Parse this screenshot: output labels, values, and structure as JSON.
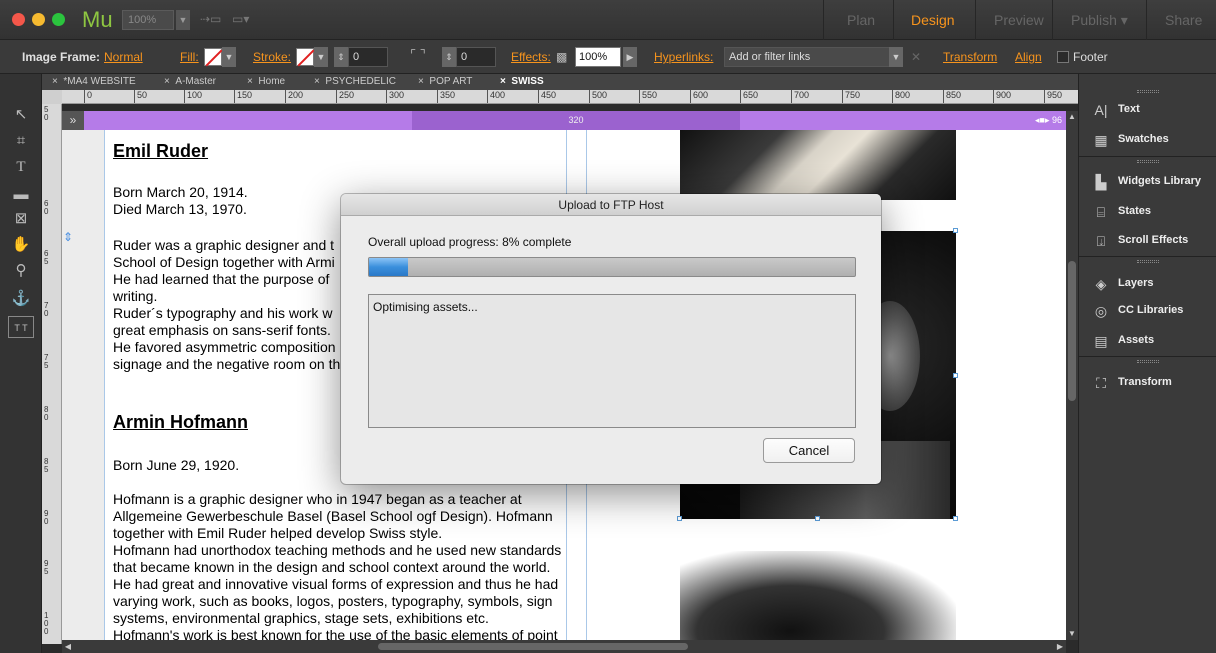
{
  "app": {
    "logo": "Mu",
    "zoom": "100%",
    "modes": [
      "Plan",
      "Design",
      "Preview",
      "Publish",
      "Share"
    ],
    "active_mode": "Design"
  },
  "control_bar": {
    "image_frame_label": "Image Frame:",
    "image_frame_value": "Normal",
    "fill_label": "Fill:",
    "stroke_label": "Stroke:",
    "stroke_value": "0",
    "corner_value": "0",
    "effects_label": "Effects:",
    "opacity": "100%",
    "hyperlinks_label": "Hyperlinks:",
    "hyperlinks_placeholder": "Add or filter links",
    "transform_label": "Transform",
    "align_label": "Align",
    "footer_label": "Footer"
  },
  "doc_tabs": [
    "*MA4 WEBSITE",
    "A-Master",
    "Home",
    "PSYCHEDELIC",
    "POP ART",
    "SWISS"
  ],
  "active_tab": "SWISS",
  "ruler": {
    "h_ticks": [
      "0",
      "50",
      "100",
      "150",
      "200",
      "250",
      "300",
      "350",
      "400",
      "450",
      "500",
      "550",
      "600",
      "650",
      "700",
      "750",
      "800",
      "850",
      "900",
      "950"
    ],
    "v_ticks": [
      "50",
      "60",
      "65",
      "70",
      "75",
      "80",
      "85",
      "90",
      "95",
      "100"
    ]
  },
  "breakpoint": {
    "width_label": "320",
    "right_label": "96"
  },
  "document": {
    "heading1": "Emil Ruder",
    "born1": "Born March 20, 1914.",
    "died1": "Died March 13, 1970.",
    "p1_lines": [
      "Ruder was a graphic designer and t",
      "School of Design together with Armi",
      "He had learned that the purpose of",
      "writing.",
      "Ruder´s typography and his work w",
      "great emphasis on sans-serif fonts.",
      "He favored asymmetric composition",
      "signage and the negative room on th"
    ],
    "heading2": "Armin Hofmann",
    "born2": "Born June 29, 1920.",
    "p2_lines": [
      "Hofmann is a graphic designer who in 1947 began as a teacher at",
      "Allgemeine Gewerbeschule Basel (Basel School ogf Design). Hofmann",
      "together with Emil Ruder helped develop Swiss style.",
      "Hofmann had unorthodox teaching methods and he used new standards",
      "that became known in the design and school context around the world.",
      "He had great and innovative visual forms of expression and thus he had",
      "varying work, such as books, logos, posters, typography, symbols, sign",
      "systems, environmental graphics, stage sets, exhibitions etc.",
      "Hofmann's work is best known for the use of the basic elements of point"
    ]
  },
  "right_panel": {
    "items": [
      "Text",
      "Swatches",
      "Widgets Library",
      "States",
      "Scroll Effects",
      "Layers",
      "CC Libraries",
      "Assets",
      "Transform"
    ]
  },
  "dialog": {
    "title": "Upload to FTP Host",
    "progress_label": "Overall upload progress: 8% complete",
    "progress_fraction": 0.08,
    "log_text": "Optimising assets...",
    "cancel_label": "Cancel"
  }
}
